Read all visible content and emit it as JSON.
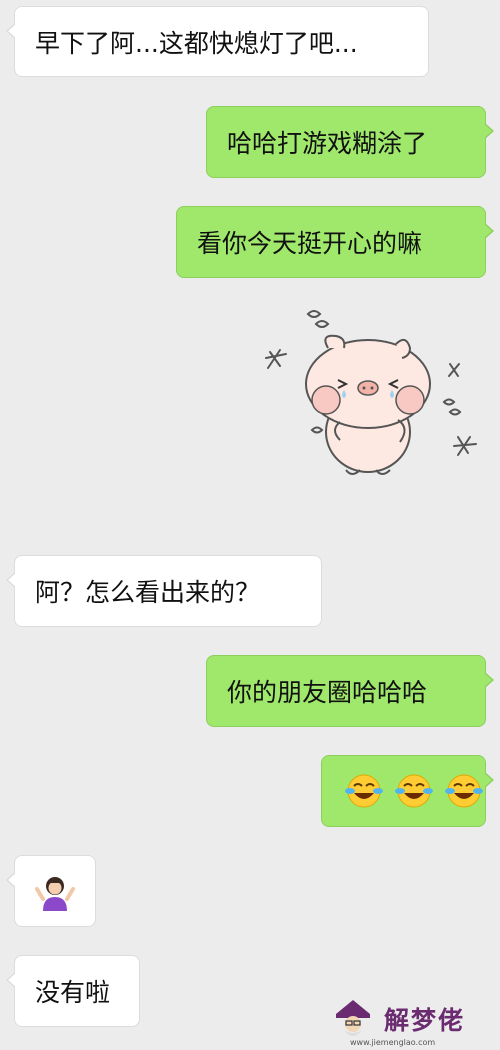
{
  "messages": [
    {
      "side": "left",
      "text": "早下了阿...这都快熄灯了吧..."
    },
    {
      "side": "right",
      "text": "哈哈打游戏糊涂了"
    },
    {
      "side": "right",
      "text": "看你今天挺开心的嘛"
    },
    {
      "side": "right",
      "type": "sticker",
      "sticker": "pig-sticker"
    },
    {
      "side": "left",
      "text": "阿？怎么看出来的？"
    },
    {
      "side": "right",
      "text": "你的朋友圈哈哈哈"
    },
    {
      "side": "right",
      "type": "emoji",
      "emoji": [
        "face-with-tears-of-joy",
        "face-with-tears-of-joy",
        "face-with-tears-of-joy"
      ]
    },
    {
      "side": "left",
      "type": "emoji",
      "emoji": [
        "woman-shrugging"
      ]
    },
    {
      "side": "left",
      "text": "没有啦"
    }
  ],
  "watermark": {
    "text": "解梦佬",
    "url": "www.jiemenglao.com",
    "icon": "wizard-logo-icon"
  },
  "colors": {
    "background": "#ececec",
    "incoming_bubble": "#ffffff",
    "outgoing_bubble": "#9fe86b"
  }
}
